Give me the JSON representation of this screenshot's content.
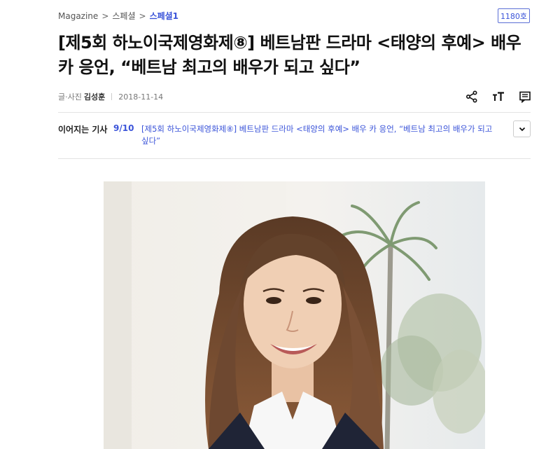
{
  "breadcrumb": {
    "root": "Magazine",
    "sep1": ">",
    "section": "스페셜",
    "sep2": ">",
    "current": "스페셜1"
  },
  "issue_badge": "1180호",
  "article": {
    "title": "[제5회 하노이국제영화제⑧] 베트남판 드라마 <태양의 후예> 배우 카 응언, “베트남 최고의 배우가 되고 싶다”",
    "byline_label": "글·사진",
    "author": "김성훈",
    "date": "2018-11-14"
  },
  "toolbar": {
    "share_icon": "share-icon",
    "font_size_icon": "font-size-icon",
    "comment_icon": "comment-icon"
  },
  "series": {
    "label": "이어지는 기사",
    "count": "9/10",
    "link_text": "[제5회 하노이국제영화제⑧] 베트남판 드라마 <태양의 후예> 배우 카 응언, “베트남 최고의 배우가 되고 싶다”",
    "toggle_icon": "chevron-down-icon"
  },
  "colors": {
    "accent": "#3b54d9",
    "text": "#111111",
    "muted": "#777777"
  }
}
